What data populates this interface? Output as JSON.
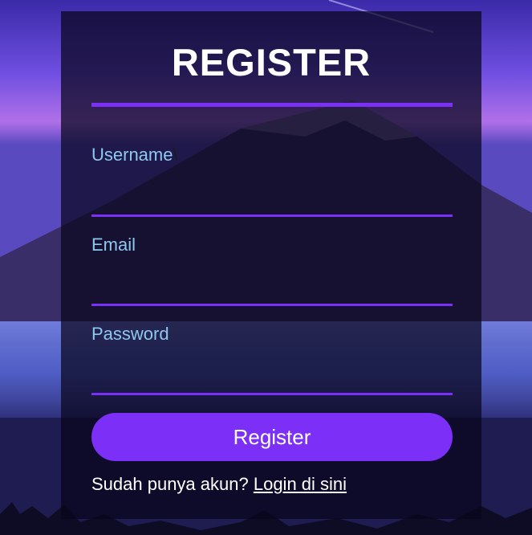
{
  "form": {
    "title": "REGISTER",
    "username_label": "Username",
    "username_stray_char": "\\",
    "username_value": "",
    "email_label": "Email",
    "email_value": "",
    "password_label": "Password",
    "password_value": "",
    "submit_label": "Register",
    "footer_prompt": "Sudah punya akun? ",
    "login_link": "Login di sini"
  },
  "colors": {
    "accent": "#7b2ff7",
    "label": "#8ec8f0",
    "card_bg": "rgba(8, 6, 28, 0.72)"
  }
}
